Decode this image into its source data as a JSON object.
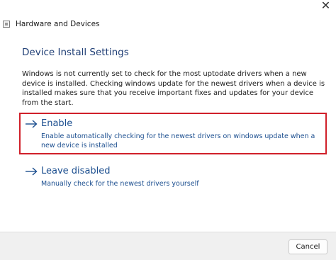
{
  "window": {
    "title": "Hardware and Devices",
    "close_glyph": "✕"
  },
  "main": {
    "heading": "Device Install Settings",
    "description": "Windows is not currently set to check for the most uptodate drivers when a new device is installed. Checking windows update for the newest drivers when a device is installed makes sure that you receive important fixes and updates for your device from the start.",
    "options": [
      {
        "title": "Enable",
        "description": "Enable automatically checking for the newest drivers on windows update when a new device is installed",
        "icon": "arrow-right-icon",
        "highlighted": true
      },
      {
        "title": "Leave disabled",
        "description": "Manually check for the newest drivers yourself",
        "icon": "arrow-right-icon",
        "highlighted": false
      }
    ]
  },
  "footer": {
    "cancel_label": "Cancel"
  },
  "colors": {
    "link_blue": "#1b4e8f",
    "heading_blue": "#1f3e75",
    "highlight_red": "#d0202a",
    "footer_bg": "#f0f0f0"
  }
}
